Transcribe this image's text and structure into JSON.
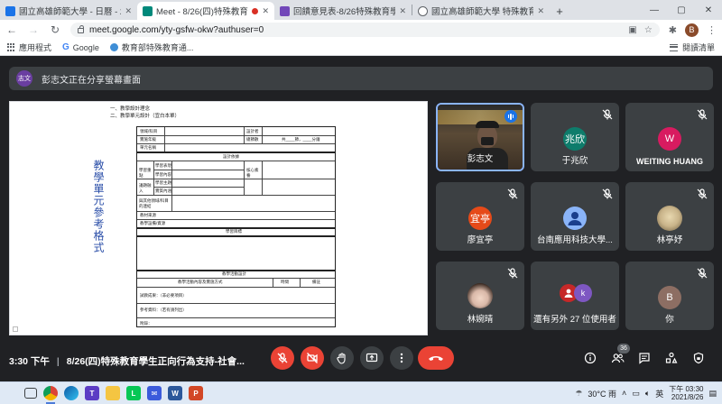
{
  "browser": {
    "tabs": [
      {
        "title": "國立高雄師範大學 - 日曆 - 2021年...",
        "favicon_color": "#1a73e8",
        "active": false
      },
      {
        "title": "Meet - 8/26(四)特殊教育學...",
        "favicon_color": "#00897b",
        "active": true
      },
      {
        "title": "回饋意見表-8/26特殊教育學生正...",
        "favicon_color": "#7248b9",
        "active": false
      },
      {
        "title": "國立高雄師範大學 特殊教育中心",
        "favicon_color": "#5f6368",
        "active": false
      }
    ],
    "new_tab": "+",
    "url": "meet.google.com/yty-gsfw-okw?authuser=0",
    "profile_initial": "B",
    "bookmarks": [
      {
        "label": "應用程式"
      },
      {
        "label": "Google"
      },
      {
        "label": "教育部特殊教育通..."
      }
    ],
    "reading_list": "閱讀清單"
  },
  "meet": {
    "presenter_chip": "志文",
    "presenter_text": "彭志文正在分享螢幕畫面",
    "document": {
      "heading_1": "一、教學設計理念",
      "heading_2": "二、教學單元設計（宜白本單）",
      "vertical_title": "教學單元參考格式",
      "form": {
        "r1": [
          "領域/科目",
          "設計者"
        ],
        "r2": [
          "實施年級",
          "總節數",
          "共____節，____分鐘"
        ],
        "r3": [
          "單元名稱"
        ],
        "section_design": "設計依據",
        "core": "核心素養",
        "learn_focus": "學習重點",
        "learn_perf": "學習表現",
        "learn_content": "學習內容",
        "topic": "議題融入",
        "topic_sub": [
          "學習主題",
          "實質內涵"
        ],
        "other": "與其他領域/科目的連結",
        "materials": "教材來源",
        "equip": "教學設備/資源",
        "goal": "學習目標",
        "activity": "教學活動設計",
        "activity_cols": [
          "教學活動內容及實施方式",
          "時間",
          "備註"
        ],
        "result": "試教成果：（非必要項目）",
        "refs": "參考資料：（若有請列出）",
        "appendix": "附錄："
      }
    },
    "participants": [
      {
        "name": "彭志文",
        "type": "camera",
        "speaking": true
      },
      {
        "name": "于兆欣",
        "avatar_text": "兆欣",
        "avatar_color": "#0e7c6b",
        "muted": true
      },
      {
        "name": "WEITING HUANG",
        "avatar_text": "W",
        "avatar_color": "#d81b60",
        "muted": true
      },
      {
        "name": "廖宜亭",
        "avatar_text": "宜亭",
        "avatar_color": "#e64a19",
        "muted": true
      },
      {
        "name": "台南應用科技大學...",
        "avatar_text": "",
        "avatar_color": "#8ab4f8",
        "muted": true
      },
      {
        "name": "林亭妤",
        "type": "photo-cat",
        "muted": true
      },
      {
        "name": "林婉晴",
        "type": "photo-kid",
        "muted": true
      },
      {
        "name": "還有另外 27 位使用者",
        "avatar_text": "k",
        "avatar_color": "#7e57c2"
      },
      {
        "name": "你",
        "avatar_text": "B",
        "avatar_color": "#8d6e63",
        "muted": true
      }
    ],
    "meeting_time": "3:30 下午",
    "meeting_title": "8/26(四)特殊教育學生正向行為支持-社會...",
    "participant_count": "36"
  },
  "taskbar": {
    "weather": "30°C 雨",
    "ime": "英",
    "time": "下午 03:30",
    "date": "2021/8/26"
  }
}
